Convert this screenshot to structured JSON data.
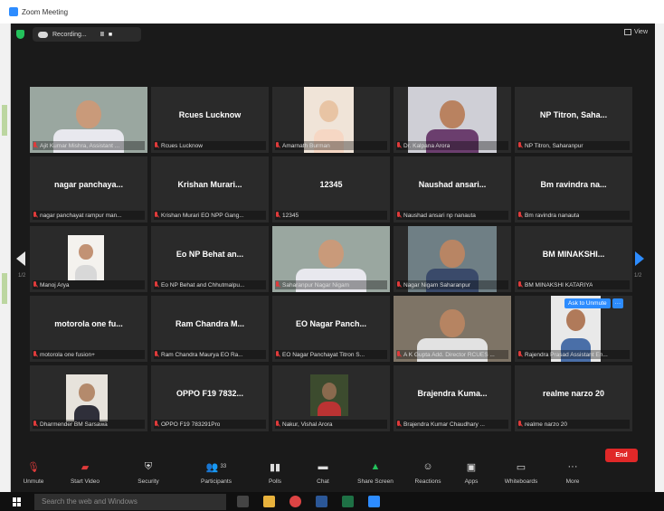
{
  "window": {
    "title": "Zoom Meeting"
  },
  "topbar": {
    "recording_label": "Recording...",
    "pause": "II",
    "stop": "■",
    "view_label": "View"
  },
  "nav": {
    "left_page": "1/2",
    "right_page": "1/2"
  },
  "tiles": [
    {
      "center": "",
      "label": "Ajit Kumar Mishra, Assistant ...",
      "video": "person"
    },
    {
      "center": "Rcues Lucknow",
      "label": "Rcues Lucknow",
      "video": ""
    },
    {
      "center": "",
      "label": "Amarnath Burman",
      "video": "cap"
    },
    {
      "center": "",
      "label": "Dr. Kalpana Arora",
      "video": "woman"
    },
    {
      "center": "NP Titron, Saha...",
      "label": "NP Titron, Saharanpur",
      "video": ""
    },
    {
      "center": "nagar panchaya...",
      "label": "nagar panchayat rampur man...",
      "video": ""
    },
    {
      "center": "Krishan Murari...",
      "label": "Krishan Murari EO NPP Gang...",
      "video": ""
    },
    {
      "center": "12345",
      "label": "12345",
      "video": ""
    },
    {
      "center": "Naushad ansari...",
      "label": "Naushad ansari np nanauta",
      "video": ""
    },
    {
      "center": "Bm ravindra na...",
      "label": "Bm ravindra nanauta",
      "video": ""
    },
    {
      "center": "",
      "label": "Manoj Arya",
      "video": "photo"
    },
    {
      "center": "Eo NP Behat an...",
      "label": "Eo NP Behat and Chhutmalpu...",
      "video": ""
    },
    {
      "center": "",
      "label": "Saharanpur Nagar Nigam",
      "video": "person"
    },
    {
      "center": "",
      "label": "Nagar Nigam Saharanpur",
      "video": "person2"
    },
    {
      "center": "BM MINAKSHI...",
      "label": "BM MINAKSHI KATARIYA",
      "video": ""
    },
    {
      "center": "motorola one fu...",
      "label": "motorola one fusion+",
      "video": ""
    },
    {
      "center": "Ram Chandra M...",
      "label": "Ram Chandra Maurya EO Ra...",
      "video": ""
    },
    {
      "center": "EO Nagar Panch...",
      "label": "EO Nagar Panchayat Titron S...",
      "video": ""
    },
    {
      "center": "",
      "label": "A K Gupta Add. Director RCUES ...",
      "video": "office",
      "active": true
    },
    {
      "center": "",
      "label": "Rajendra Prasad Assistant En...",
      "video": "person3"
    },
    {
      "center": "",
      "label": "Dharmender BM Sarsawa",
      "video": "standing"
    },
    {
      "center": "OPPO F19 7832...",
      "label": "OPPO F19 783291Pro",
      "video": ""
    },
    {
      "center": "",
      "label": "Nakur, Vishal Arora",
      "video": "field"
    },
    {
      "center": "Brajendra Kuma...",
      "label": "Brajendra Kumar Chaudhary ...",
      "video": ""
    },
    {
      "center": "realme narzo 20",
      "label": "realme narzo 20",
      "video": ""
    }
  ],
  "popover": {
    "ask_label": "Ask to Unmute",
    "more_label": "···"
  },
  "toolbar": {
    "buttons": [
      {
        "label": "Unmute",
        "icon": "mic-off-icon"
      },
      {
        "label": "Start Video",
        "icon": "video-off-icon"
      },
      {
        "label": "Security",
        "icon": "shield-icon"
      },
      {
        "label": "Participants",
        "icon": "participants-icon",
        "count": "33"
      },
      {
        "label": "Polls",
        "icon": "polls-icon"
      },
      {
        "label": "Chat",
        "icon": "chat-icon"
      },
      {
        "label": "Share Screen",
        "icon": "share-icon"
      },
      {
        "label": "Reactions",
        "icon": "reactions-icon"
      },
      {
        "label": "Apps",
        "icon": "apps-icon"
      },
      {
        "label": "Whiteboards",
        "icon": "whiteboard-icon"
      },
      {
        "label": "More",
        "icon": "more-icon"
      }
    ],
    "end_label": "End"
  },
  "taskbar": {
    "search_placeholder": "Search the web and Windows"
  },
  "colors": {
    "accent": "#2d8cff",
    "end": "#e02828",
    "share": "#23c15b",
    "active_border": "#c5e04a"
  }
}
